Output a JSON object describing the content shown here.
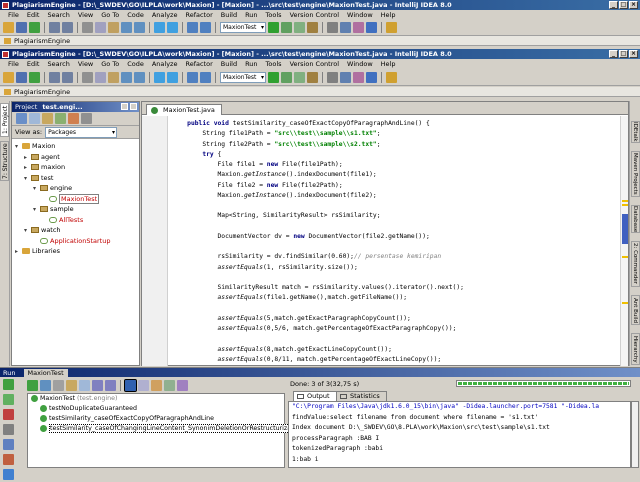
{
  "window": {
    "title": "PlagiarismEngine - [D:\\_SWDEV\\GO\\ILPLA\\work\\Maxion] - [Maxion] - ...\\src\\test\\engine\\MaxionTest.java - IntelliJ IDEA 8.0"
  },
  "menu": [
    "File",
    "Edit",
    "Search",
    "View",
    "Go To",
    "Code",
    "Analyze",
    "Refactor",
    "Build",
    "Run",
    "Tools",
    "Version Control",
    "Window",
    "Help"
  ],
  "toolbar": {
    "config_combo": "MaxionTest"
  },
  "navbar": {
    "project": "PlagiarismEngine"
  },
  "left_strip": {
    "project_tab": "1: Project",
    "structure_tab": "7: Structure"
  },
  "project_panel": {
    "title": "Project",
    "title_suffix": "test.engi...",
    "view_as_label": "View as:",
    "view_as_value": "Packages",
    "tree": [
      {
        "label": "Maxion",
        "indent": 0,
        "icon": "folder",
        "arrow": "▾"
      },
      {
        "label": "agent",
        "indent": 1,
        "icon": "package",
        "arrow": "▸"
      },
      {
        "label": "maxion",
        "indent": 1,
        "icon": "package",
        "arrow": "▸"
      },
      {
        "label": "test",
        "indent": 1,
        "icon": "package",
        "arrow": "▾"
      },
      {
        "label": "engine",
        "indent": 2,
        "icon": "package",
        "arrow": "▾"
      },
      {
        "label": "MaxionTest",
        "indent": 3,
        "icon": "class",
        "arrow": "",
        "red": true
      },
      {
        "label": "sample",
        "indent": 2,
        "icon": "package",
        "arrow": "▾"
      },
      {
        "label": "AllTests",
        "indent": 3,
        "icon": "class",
        "arrow": "",
        "red": true
      },
      {
        "label": "watch",
        "indent": 1,
        "icon": "package",
        "arrow": "▾"
      },
      {
        "label": "ApplicationStartup",
        "indent": 2,
        "icon": "class",
        "arrow": "",
        "red": true
      },
      {
        "label": "Libraries",
        "indent": 0,
        "icon": "folder",
        "arrow": "▸"
      }
    ]
  },
  "editor": {
    "tab": "MaxionTest.java",
    "code_lines": [
      "    <span class=\"kw\">public void</span> testSimilarity_caseOfExactCopyOfParagraphAndLine() {",
      "        String file1Path = <span class=\"st\">\"src\\\\test\\\\sample\\\\s1.txt\"</span>;",
      "        String file2Path = <span class=\"st\">\"src\\\\test\\\\sample\\\\s2.txt\"</span>;",
      "        <span class=\"kw\">try</span> {",
      "            File file1 = <span class=\"kw\">new</span> File(file1Path);",
      "            Maxion.<span class=\"it\">getInstance</span>().indexDocument(file1);",
      "            File file2 = <span class=\"kw\">new</span> File(file2Path);",
      "            Maxion.<span class=\"it\">getInstance</span>().indexDocument(file2);",
      "",
      "            Map&lt;String, SimilarityResult&gt; rsSimilarity;",
      "",
      "            DocumentVector dv = <span class=\"kw\">new</span> DocumentVector(file2.getName());",
      "",
      "            rsSimilarity = dv.findSimilar(0.60);<span class=\"cm\">// persentase kemiripan</span>",
      "            <span class=\"it\">assertEquals</span>(1, rsSimilarity.size());",
      "",
      "            SimilarityResult match = rsSimilarity.values().iterator().next();",
      "            <span class=\"it\">assertEquals</span>(file1.getName(),match.getFileName());",
      "",
      "            <span class=\"it\">assertEquals</span>(5,match.getExactParagraphCopyCount());",
      "            <span class=\"it\">assertEquals</span>(0,5/6, match.getPercentageOfExactParagraphCopy());",
      "",
      "            <span class=\"it\">assertEquals</span>(8,match.getExactLineCopyCount());",
      "            <span class=\"it\">assertEquals</span>(0,8/11, match.getPercentageOfExactLineCopy());"
    ]
  },
  "right_strip": [
    "IDEtalk",
    "Maven Projects",
    "Database",
    "2: Commander",
    "Ant Build",
    "Hierarchy"
  ],
  "run_panel": {
    "header": "Run",
    "tab": "MaxionTest",
    "tree": [
      {
        "label": "MaxionTest",
        "suffix": "(test.engine)",
        "indent": 0
      },
      {
        "label": "testNoDuplicateGuaranteed",
        "indent": 1
      },
      {
        "label": "testSimilarity_caseOfExactCopyOfParagraphAndLine",
        "indent": 1
      },
      {
        "label": "testSimilarity_caseOfChangingLineContent_SynonimDeletionOrRestructurization",
        "indent": 1,
        "selected": true
      }
    ],
    "status": "Done: 3 of 3(32,75 s)",
    "progress": 1.0,
    "tabs": [
      "Output",
      "Statistics"
    ],
    "console": [
      "\"C:\\Program Files\\Java\\jdk1.6.0_15\\bin\\java\" -Didea.launcher.port=7581 \"-Didea.la",
      "findValue:select filename from document where filename = 's1.txt'",
      "Index document D:\\_SWDEV\\GO\\8.PLA\\work\\Maxion\\src\\test\\sample\\s1.txt",
      "processParagraph :BAB I",
      "tokenizedParagraph :babi",
      "1:bab i",
      "processLine :bab i"
    ]
  }
}
